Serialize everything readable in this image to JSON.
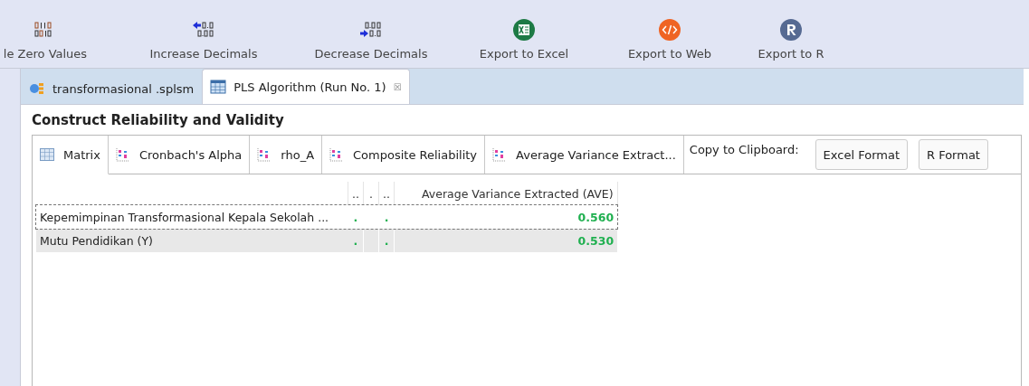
{
  "toolbar": [
    {
      "kind": "zero",
      "label": "le Zero Values"
    },
    {
      "kind": "inc",
      "label": "Increase Decimals"
    },
    {
      "kind": "dec",
      "label": "Decrease Decimals"
    },
    {
      "kind": "excel",
      "label": "Export to Excel"
    },
    {
      "kind": "web",
      "label": "Export to Web"
    },
    {
      "kind": "r",
      "label": "Export to R"
    }
  ],
  "editor_tabs": [
    {
      "kind": "model",
      "label": "transformasional .splsm",
      "selected": false
    },
    {
      "kind": "table",
      "label": "PLS Algorithm (Run No. 1)",
      "selected": true,
      "close": "☒"
    }
  ],
  "section_title": "Construct Reliability and Validity",
  "view_tabs": [
    {
      "kind": "matrix",
      "label": "Matrix",
      "selected": true
    },
    {
      "kind": "chart",
      "label": "Cronbach's Alpha",
      "selected": false
    },
    {
      "kind": "chart",
      "label": "rho_A",
      "selected": false
    },
    {
      "kind": "chart",
      "label": "Composite Reliability",
      "selected": false
    },
    {
      "kind": "chart",
      "label": "Average Variance Extract...",
      "selected": false
    }
  ],
  "clipboard": {
    "label": "Copy to Clipboard:",
    "buttons": [
      "Excel Format",
      "R Format"
    ]
  },
  "table": {
    "columns": [
      "..",
      ".",
      "..",
      "Average Variance Extracted (AVE)"
    ],
    "rows": [
      {
        "name": "Kepemimpinan Transformasional Kepala Sekolah  ...",
        "col_1": ".",
        "col_3": ".",
        "value": "0.560",
        "selected": true
      },
      {
        "name": "Mutu Pendidikan (Y)",
        "col_1": ".",
        "col_3": ".",
        "value": "0.530",
        "selected": false
      }
    ]
  }
}
